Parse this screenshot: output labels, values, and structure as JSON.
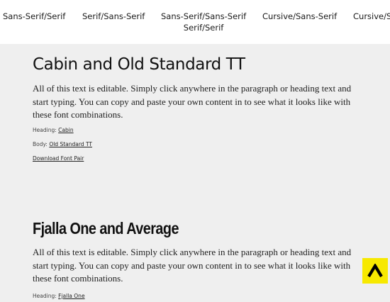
{
  "nav": {
    "items": [
      {
        "lines": [
          "Sans-Serif/Serif"
        ]
      },
      {
        "lines": [
          "Serif/Sans-Serif"
        ]
      },
      {
        "lines": [
          "Sans-Serif/Sans-Serif",
          "Serif/Serif"
        ]
      },
      {
        "lines": [
          "Cursive/Sans-Serif"
        ]
      },
      {
        "lines": [
          "Cursive/S"
        ]
      }
    ]
  },
  "pairs": [
    {
      "heading": "Cabin and Old Standard TT",
      "body": "All of this text is editable. Simply click anywhere in the paragraph or heading text and start typing. You can copy and paste your own content in to see what it looks like with these font combinations.",
      "heading_label": "Heading:",
      "heading_font": "Cabin",
      "body_label": "Body:",
      "body_font": "Old Standard TT",
      "download_label": "Download Font Pair"
    },
    {
      "heading": "Fjalla One and Average",
      "body": "All of this text is editable. Simply click anywhere in the paragraph or heading text and start typing. You can copy and paste your own content in to see what it looks like with these font combinations.",
      "heading_label": "Heading:",
      "heading_font": "Fjalla One"
    }
  ],
  "scroll_top": {
    "icon": "chevron-up-icon",
    "color": "#f7e900"
  }
}
